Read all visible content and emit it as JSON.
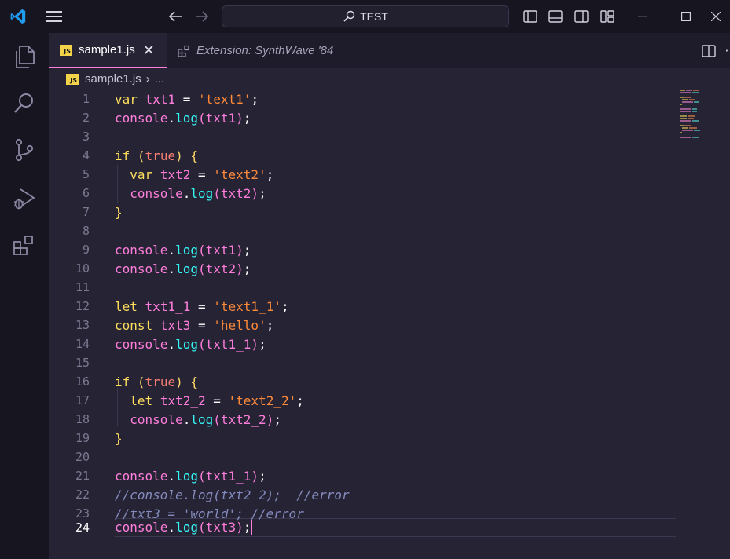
{
  "titlebar": {
    "search_text": "TEST"
  },
  "tabs": [
    {
      "label": "sample1.js",
      "badge": "JS",
      "active": true
    },
    {
      "label": "Extension: SynthWave '84",
      "active": false
    }
  ],
  "breadcrumb": {
    "file": "sample1.js",
    "badge": "JS",
    "rest": "..."
  },
  "editor": {
    "active_line": 24,
    "lines": [
      {
        "n": "1"
      },
      {
        "n": "2"
      },
      {
        "n": "3"
      },
      {
        "n": "4"
      },
      {
        "n": "5"
      },
      {
        "n": "6"
      },
      {
        "n": "7"
      },
      {
        "n": "8"
      },
      {
        "n": "9"
      },
      {
        "n": "10"
      },
      {
        "n": "11"
      },
      {
        "n": "12"
      },
      {
        "n": "13"
      },
      {
        "n": "14"
      },
      {
        "n": "15"
      },
      {
        "n": "16"
      },
      {
        "n": "17"
      },
      {
        "n": "18"
      },
      {
        "n": "19"
      },
      {
        "n": "20"
      },
      {
        "n": "21"
      },
      {
        "n": "22"
      },
      {
        "n": "23"
      },
      {
        "n": "24"
      }
    ],
    "code": {
      "l1": {
        "kw": "var",
        "name": "txt1",
        "op": "=",
        "str": "'text1'",
        "end": ";"
      },
      "l2": {
        "obj": "console",
        "dot": ".",
        "fn": "log",
        "arg": "txt1",
        "end": ";"
      },
      "l4": {
        "kw": "if",
        "bool": "true",
        "brace": "{"
      },
      "l5": {
        "kw": "var",
        "name": "txt2",
        "op": "=",
        "str": "'text2'",
        "end": ";"
      },
      "l6": {
        "obj": "console",
        "dot": ".",
        "fn": "log",
        "arg": "txt2",
        "end": ";"
      },
      "l7": {
        "brace": "}"
      },
      "l9": {
        "obj": "console",
        "dot": ".",
        "fn": "log",
        "arg": "txt1",
        "end": ";"
      },
      "l10": {
        "obj": "console",
        "dot": ".",
        "fn": "log",
        "arg": "txt2",
        "end": ";"
      },
      "l12": {
        "kw": "let",
        "name": "txt1_1",
        "op": "=",
        "str": "'text1_1'",
        "end": ";"
      },
      "l13": {
        "kw": "const",
        "name": "txt3",
        "op": "=",
        "str": "'hello'",
        "end": ";"
      },
      "l14": {
        "obj": "console",
        "dot": ".",
        "fn": "log",
        "arg": "txt1_1",
        "end": ";"
      },
      "l16": {
        "kw": "if",
        "bool": "true",
        "brace": "{"
      },
      "l17": {
        "kw": "let",
        "name": "txt2_2",
        "op": "=",
        "str": "'text2_2'",
        "end": ";"
      },
      "l18": {
        "obj": "console",
        "dot": ".",
        "fn": "log",
        "arg": "txt2_2",
        "end": ";"
      },
      "l19": {
        "brace": "}"
      },
      "l21": {
        "obj": "console",
        "dot": ".",
        "fn": "log",
        "arg": "txt1_1",
        "end": ";"
      },
      "l22": {
        "comment": "//console.log(txt2_2);  //error"
      },
      "l23": {
        "comment": "//txt3 = 'world'; //error"
      },
      "l24": {
        "obj": "console",
        "dot": ".",
        "fn": "log",
        "arg": "txt3",
        "end": ";"
      }
    }
  },
  "colors": {
    "background": "#262335",
    "keyword": "#fede5d",
    "variable": "#ff7edb",
    "string": "#ff8b39",
    "function": "#36f9f6",
    "comment": "#848bbd"
  }
}
